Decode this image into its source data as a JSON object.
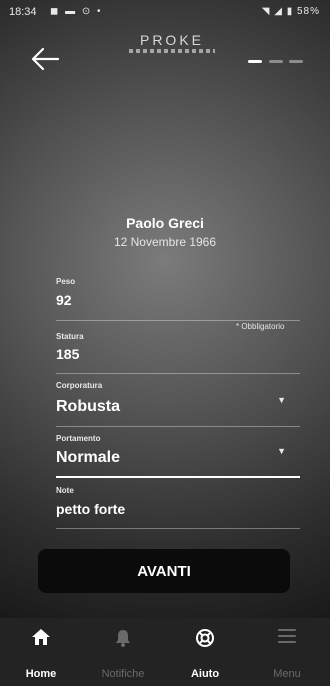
{
  "status_bar": {
    "time": "18:34",
    "left_icons": "◼ ▬ ⊙ •",
    "right_icons": "◥ ◢ ▮",
    "battery": "58%"
  },
  "header": {
    "logo": "PROKE",
    "back_icon": "arrow-left-icon",
    "step": 1,
    "steps_total": 3
  },
  "profile": {
    "name": "Paolo Greci",
    "birth_date": "12 Novembre 1966"
  },
  "form": {
    "required_note": "* Obbligatorio",
    "fields": [
      {
        "label": "Peso",
        "value": "92"
      },
      {
        "label": "Statura",
        "value": "185"
      },
      {
        "label": "Corporatura",
        "value": "Robusta"
      },
      {
        "label": "Portamento",
        "value": "Normale"
      },
      {
        "label": "Note",
        "value": "petto forte"
      }
    ]
  },
  "cta": {
    "label": "AVANTI"
  },
  "tabbar": {
    "tabs": [
      {
        "label": "Home",
        "icon": "home-icon",
        "active": true
      },
      {
        "label": "Notifiche",
        "icon": "bell-icon",
        "active": false
      },
      {
        "label": "Aiuto",
        "icon": "lifebuoy-icon",
        "active": true
      },
      {
        "label": "Menu",
        "icon": "menu-icon",
        "active": false
      }
    ]
  },
  "colors": {
    "button": "#0b0b0b",
    "tabbar": "#232323",
    "inactive_tab": "#6a6a6a"
  }
}
